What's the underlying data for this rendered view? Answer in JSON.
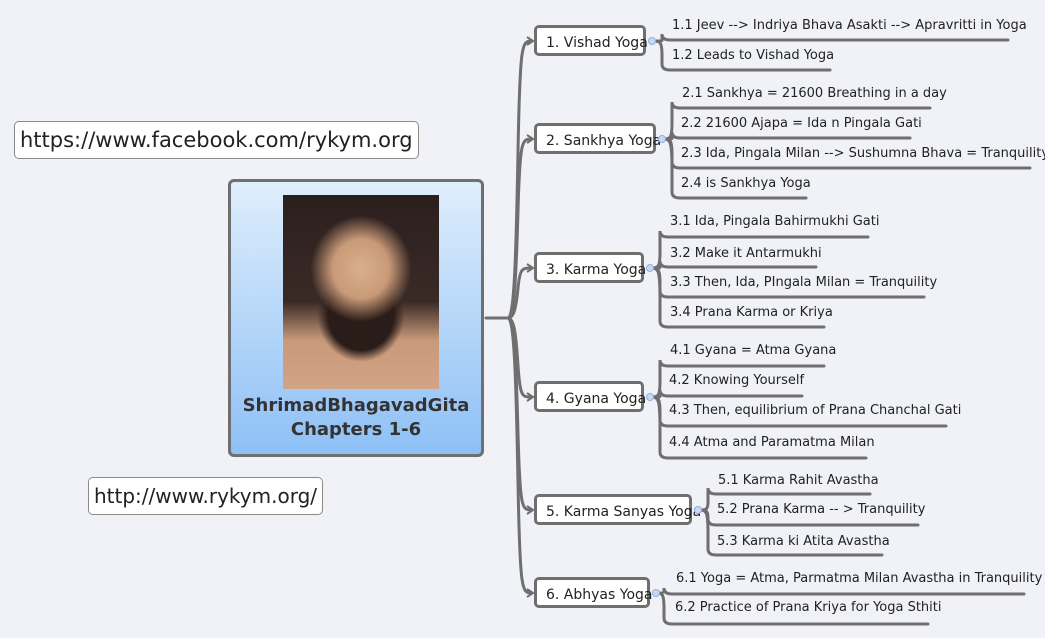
{
  "links": {
    "facebook": "https://www.facebook.com/rykym.org",
    "website": "http://www.rykym.org/"
  },
  "central": {
    "image": "portrait-photo",
    "title_line1": "ShrimadBhagavadGita",
    "title_line2": "Chapters 1-6"
  },
  "topics": [
    {
      "label": "1. Vishad Yoga",
      "subtopics": [
        "1.1 Jeev --> Indriya Bhava Asakti --> Apravritti in Yoga",
        "1.2 Leads to Vishad Yoga"
      ]
    },
    {
      "label": "2. Sankhya Yoga",
      "subtopics": [
        "2.1 Sankhya = 21600 Breathing in a day",
        "2.2 21600 Ajapa = Ida n Pingala Gati",
        "2.3 Ida, Pingala Milan --> Sushumna Bhava = Tranquility",
        "2.4 is Sankhya Yoga"
      ]
    },
    {
      "label": "3. Karma Yoga",
      "subtopics": [
        "3.1 Ida, Pingala Bahirmukhi Gati",
        "3.2 Make it Antarmukhi",
        "3.3 Then, Ida, PIngala Milan = Tranquility",
        "3.4 Prana Karma or Kriya"
      ]
    },
    {
      "label": "4. Gyana Yoga",
      "subtopics": [
        "4.1 Gyana = Atma Gyana",
        "4.2 Knowing Yourself",
        "4.3 Then, equilibrium of Prana Chanchal Gati",
        "4.4 Atma and Paramatma Milan"
      ]
    },
    {
      "label": "5. Karma Sanyas Yoga",
      "subtopics": [
        "5.1 Karma Rahit Avastha",
        "5.2 Prana Karma -- > Tranquility",
        "5.3 Karma ki Atita Avastha"
      ]
    },
    {
      "label": "6. Abhyas Yoga",
      "subtopics": [
        "6.1 Yoga = Atma, Parmatma Milan Avastha in Tranquility",
        "6.2 Practice of Prana Kriya for Yoga Sthiti"
      ]
    }
  ],
  "colors": {
    "background": "#f1f2f7",
    "line": "#6f6f6f",
    "central_top": "#dfeefc",
    "central_bottom": "#8ec0f6"
  }
}
